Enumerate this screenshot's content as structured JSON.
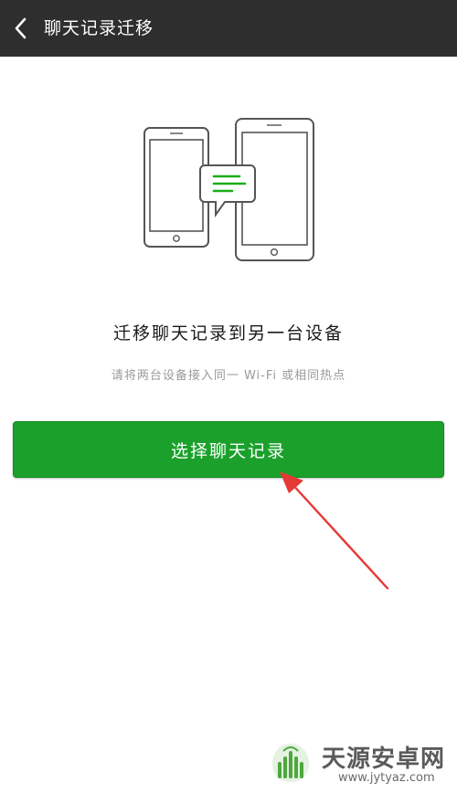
{
  "header": {
    "back_icon": "chevron-left-icon",
    "title": "聊天记录迁移"
  },
  "illustration": {
    "icon": "phone-to-phone-transfer-icon",
    "accent_color": "#1aad19"
  },
  "main": {
    "title": "迁移聊天记录到另一台设备",
    "subtitle": "请将两台设备接入同一 Wi-Fi 或相同热点",
    "select_button_label": "选择聊天记录",
    "button_color": "#1ba12b"
  },
  "annotation": {
    "arrow_color": "#e53935"
  },
  "watermark": {
    "brand": "天源安卓网",
    "url": "www.jytyaz.com"
  }
}
